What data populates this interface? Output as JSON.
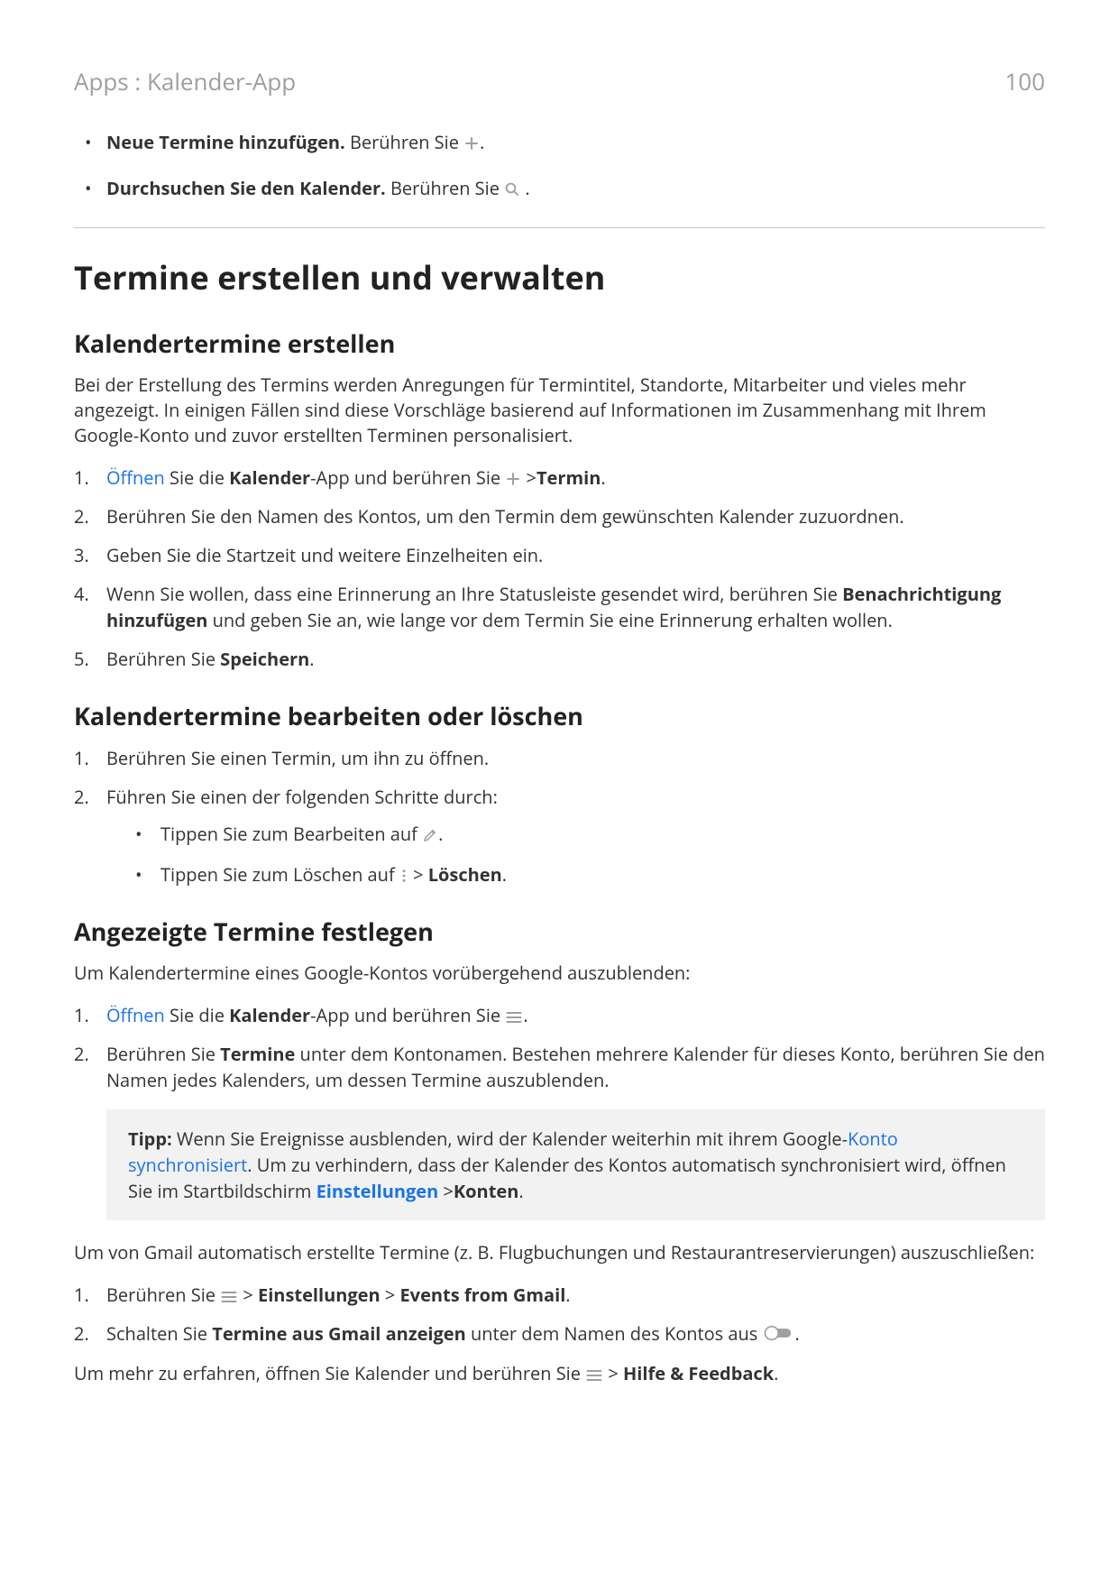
{
  "header": {
    "breadcrumb": "Apps : Kalender-App",
    "page_number": "100"
  },
  "top_bullets": {
    "b1": {
      "bold": "Neue Termine hinzufügen.",
      "text": " Berühren Sie ",
      "tail": "."
    },
    "b2": {
      "bold": "Durchsuchen Sie den Kalender.",
      "text": " Berühren Sie ",
      "tail": " ."
    }
  },
  "h1": "Termine erstellen und verwalten",
  "sec1": {
    "title": "Kalendertermine erstellen",
    "para": "Bei der Erstellung des Termins werden Anregungen für Termintitel, Standorte, Mitarbeiter und vieles mehr angezeigt. In einigen Fällen sind diese Vorschläge basierend auf Informationen im Zusammenhang mit Ihrem Google-Konto und zuvor erstellten Terminen personalisiert.",
    "step1": {
      "link": "Öffnen",
      "t1": " Sie die ",
      "b1": "Kalender",
      "t2": "-App und berühren Sie ",
      "gt": " >",
      "b2": "Termin",
      "tail": "."
    },
    "step2": "Berühren Sie den Namen des Kontos, um den Termin dem gewünschten Kalender zuzuordnen.",
    "step3": "Geben Sie die Startzeit und weitere Einzelheiten ein.",
    "step4": {
      "t1": "Wenn Sie wollen, dass eine Erinnerung an Ihre Statusleiste gesendet wird, berühren Sie ",
      "b1": "Benachrichtigung hinzufügen",
      "t2": " und geben Sie an, wie lange vor dem Termin Sie eine Erinnerung erhalten wollen."
    },
    "step5": {
      "t1": "Berühren Sie ",
      "b1": "Speichern",
      "tail": "."
    }
  },
  "sec2": {
    "title": "Kalendertermine bearbeiten oder löschen",
    "step1": "Berühren Sie einen Termin, um ihn zu öffnen.",
    "step2": "Führen Sie einen der folgenden Schritte durch:",
    "sub1": {
      "t1": "Tippen Sie zum Bearbeiten auf ",
      "tail": "."
    },
    "sub2": {
      "t1": "Tippen Sie zum Löschen auf ",
      "gt": " > ",
      "b1": "Löschen",
      "tail": "."
    }
  },
  "sec3": {
    "title": "Angezeigte Termine festlegen",
    "para1": "Um Kalendertermine eines Google-Kontos vorübergehend auszublenden:",
    "step1": {
      "link": "Öffnen",
      "t1": " Sie die ",
      "b1": "Kalender",
      "t2": "-App und berühren Sie ",
      "tail": "."
    },
    "step2": {
      "t1": "Berühren Sie ",
      "b1": "Termine",
      "t2": " unter dem Kontonamen. Bestehen mehrere Kalender für dieses Konto, berühren Sie den Namen jedes Kalenders, um dessen Termine auszublenden."
    },
    "tip": {
      "label": "Tipp:",
      "t1": " Wenn Sie Ereignisse ausblenden, wird der Kalender weiterhin mit ihrem Google-",
      "link1": "Konto synchronisiert",
      "t2": ". Um zu verhindern, dass der Kalender des Kontos automatisch synchronisiert wird, öffnen Sie im Startbildschirm ",
      "link2": "Einstellungen",
      "gt": " >",
      "b1": "Konten",
      "tail": "."
    },
    "para2": "Um von Gmail automatisch erstellte Termine (z. B. Flugbuchungen und Restaurantreservierungen) auszuschließen:",
    "ex_step1": {
      "t1": "Berühren Sie ",
      "gt1": " > ",
      "b1": "Einstellungen",
      "gt2": " > ",
      "b2": "Events from Gmail",
      "tail": "."
    },
    "ex_step2": {
      "t1": "Schalten Sie ",
      "b1": "Termine aus Gmail anzeigen",
      "t2": " unter dem Namen des Kontos aus ",
      "tail": "."
    },
    "para3": {
      "t1": "Um mehr zu erfahren, öffnen Sie Kalender und berühren Sie ",
      "gt": " > ",
      "b1": "Hilfe & Feedback",
      "tail": "."
    }
  }
}
